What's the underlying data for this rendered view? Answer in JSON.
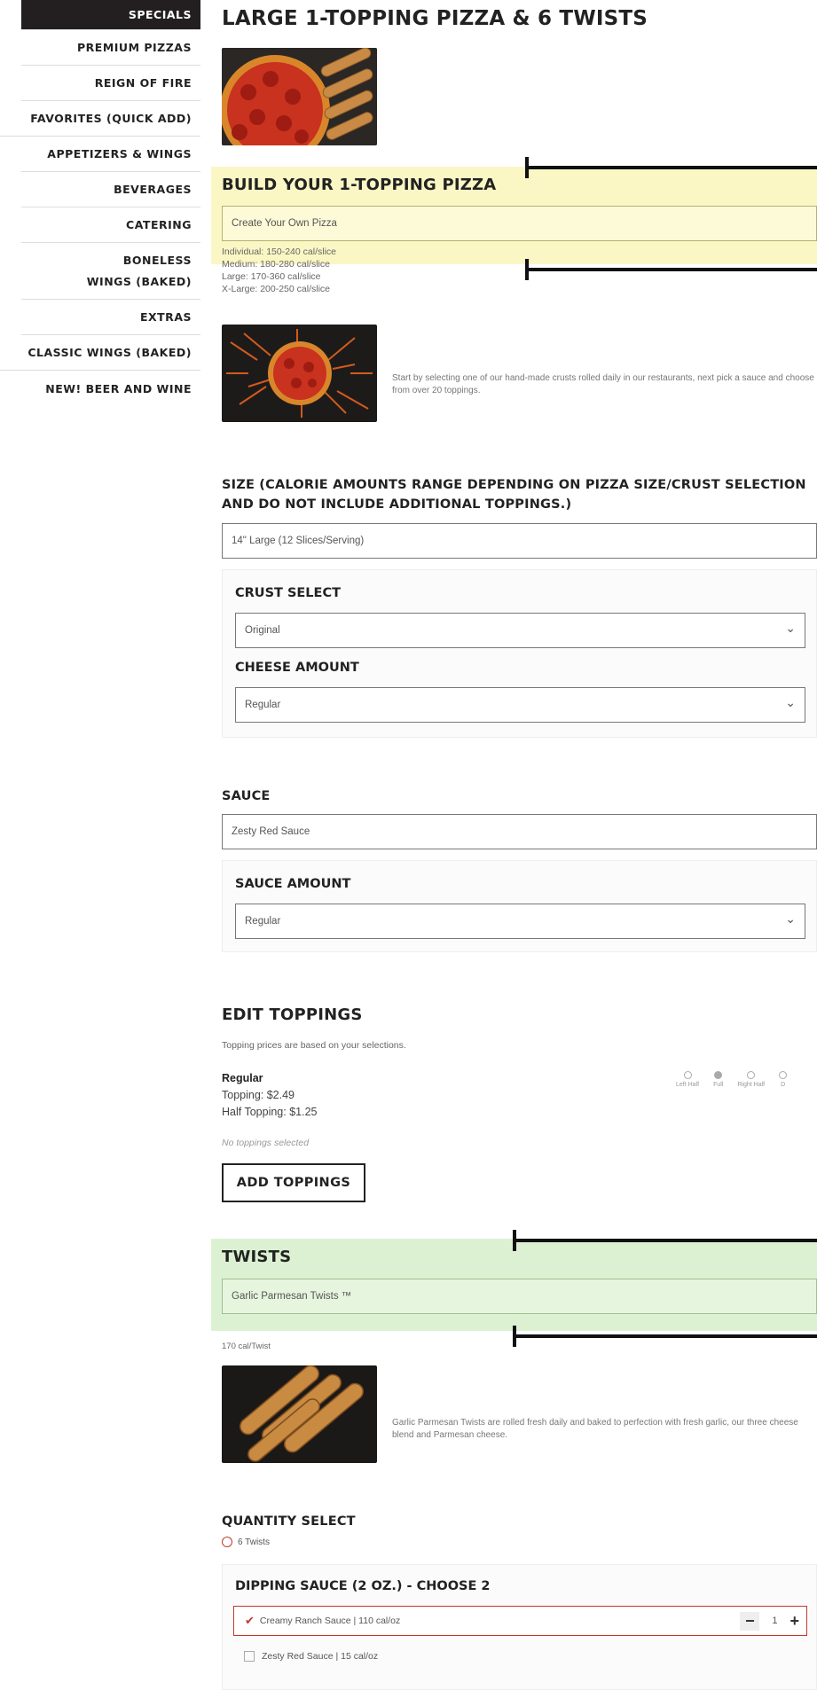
{
  "sidebar": {
    "items": [
      {
        "label": "SPECIALS"
      },
      {
        "label": "PREMIUM PIZZAS"
      },
      {
        "label": "REIGN OF FIRE"
      },
      {
        "label": "FAVORITES (QUICK ADD)"
      },
      {
        "label": "APPETIZERS & WINGS"
      },
      {
        "label": "BEVERAGES"
      },
      {
        "label": "CATERING"
      },
      {
        "label": "BONELESS WINGS (BAKED)"
      },
      {
        "label": "EXTRAS"
      },
      {
        "label": "CLASSIC WINGS (BAKED)"
      },
      {
        "label": "NEW! BEER AND WINE"
      }
    ]
  },
  "product": {
    "title": "LARGE 1-TOPPING PIZZA & 6 TWISTS"
  },
  "pizza": {
    "section_title": "BUILD YOUR 1-TOPPING PIZZA",
    "selected": "Create Your Own Pizza",
    "calories": [
      "Individual: 150-240 cal/slice",
      "Medium: 180-280 cal/slice",
      "Large: 170-360 cal/slice",
      "X-Large: 200-250 cal/slice"
    ],
    "description": "Start by selecting one of our hand-made crusts rolled daily in our restaurants, next pick a sauce and choose from over 20 toppings."
  },
  "size": {
    "label": "SIZE (CALORIE AMOUNTS RANGE DEPENDING ON PIZZA SIZE/CRUST SELECTION AND DO NOT INCLUDE ADDITIONAL TOPPINGS.)",
    "value": "14\" Large (12 Slices/Serving)",
    "crust_label": "CRUST SELECT",
    "crust_value": "Original",
    "cheese_label": "CHEESE AMOUNT",
    "cheese_value": "Regular"
  },
  "sauce": {
    "label": "SAUCE",
    "value": "Zesty Red Sauce",
    "amount_label": "SAUCE AMOUNT",
    "amount_value": "Regular"
  },
  "toppings": {
    "title": "EDIT TOPPINGS",
    "note": "Topping prices are based on your selections.",
    "tier": "Regular",
    "topping_price": "Topping: $2.49",
    "half_price": "Half Topping: $1.25",
    "empty": "No toppings selected",
    "add_button": "ADD TOPPINGS",
    "placements": [
      "Left Half",
      "Full",
      "Right Half",
      "D"
    ]
  },
  "twists": {
    "section_title": "TWISTS",
    "selected": "Garlic Parmesan Twists ™",
    "calories": "170 cal/Twist",
    "description": "Garlic Parmesan Twists are rolled fresh daily and baked to perfection with fresh garlic, our three cheese blend and Parmesan cheese."
  },
  "quantity": {
    "label": "QUANTITY SELECT",
    "value": "6 Twists"
  },
  "dipping": {
    "label": "DIPPING SAUCE (2 OZ.) - CHOOSE 2",
    "options": [
      {
        "label": "Creamy Ranch Sauce | 110 cal/oz",
        "qty": "1",
        "checked": true
      },
      {
        "label": "Zesty Red Sauce | 15 cal/oz",
        "checked": false
      }
    ]
  }
}
